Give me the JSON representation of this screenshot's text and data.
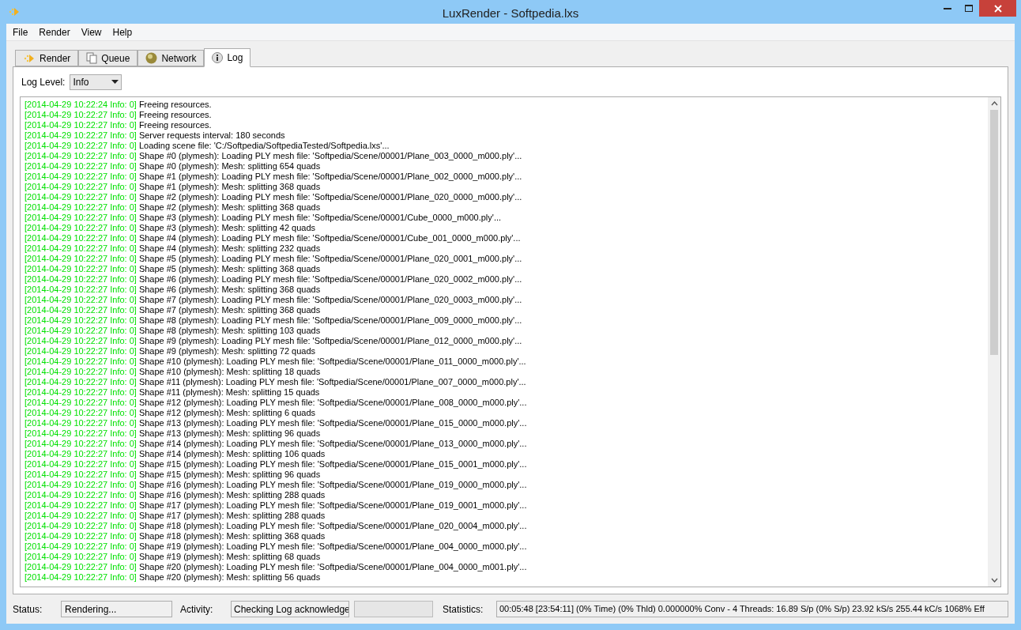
{
  "window": {
    "title": "LuxRender - Softpedia.lxs"
  },
  "menu": [
    "File",
    "Render",
    "View",
    "Help"
  ],
  "tabs": [
    {
      "label": "Render",
      "kind": "render",
      "selected": false
    },
    {
      "label": "Queue",
      "kind": "queue",
      "selected": false
    },
    {
      "label": "Network",
      "kind": "network",
      "selected": false
    },
    {
      "label": "Log",
      "kind": "info",
      "selected": true
    }
  ],
  "log_level": {
    "label": "Log Level:",
    "value": "Info"
  },
  "log": [
    {
      "prefix": "[2014-04-29 10:22:24 Info: 0]",
      "message": "Freeing resources."
    },
    {
      "prefix": "[2014-04-29 10:22:27 Info: 0]",
      "message": "Freeing resources."
    },
    {
      "prefix": "[2014-04-29 10:22:27 Info: 0]",
      "message": "Freeing resources."
    },
    {
      "prefix": "[2014-04-29 10:22:27 Info: 0]",
      "message": "Server requests interval: 180 seconds"
    },
    {
      "prefix": "[2014-04-29 10:22:27 Info: 0]",
      "message": "Loading scene file: 'C:/Softpedia/SoftpediaTested/Softpedia.lxs'..."
    },
    {
      "prefix": "[2014-04-29 10:22:27 Info: 0]",
      "message": "Shape #0 (plymesh): Loading PLY mesh file: 'Softpedia/Scene/00001/Plane_003_0000_m000.ply'..."
    },
    {
      "prefix": "[2014-04-29 10:22:27 Info: 0]",
      "message": "Shape #0 (plymesh): Mesh: splitting 654 quads"
    },
    {
      "prefix": "[2014-04-29 10:22:27 Info: 0]",
      "message": "Shape #1 (plymesh): Loading PLY mesh file: 'Softpedia/Scene/00001/Plane_002_0000_m000.ply'..."
    },
    {
      "prefix": "[2014-04-29 10:22:27 Info: 0]",
      "message": "Shape #1 (plymesh): Mesh: splitting 368 quads"
    },
    {
      "prefix": "[2014-04-29 10:22:27 Info: 0]",
      "message": "Shape #2 (plymesh): Loading PLY mesh file: 'Softpedia/Scene/00001/Plane_020_0000_m000.ply'..."
    },
    {
      "prefix": "[2014-04-29 10:22:27 Info: 0]",
      "message": "Shape #2 (plymesh): Mesh: splitting 368 quads"
    },
    {
      "prefix": "[2014-04-29 10:22:27 Info: 0]",
      "message": "Shape #3 (plymesh): Loading PLY mesh file: 'Softpedia/Scene/00001/Cube_0000_m000.ply'..."
    },
    {
      "prefix": "[2014-04-29 10:22:27 Info: 0]",
      "message": "Shape #3 (plymesh): Mesh: splitting 42 quads"
    },
    {
      "prefix": "[2014-04-29 10:22:27 Info: 0]",
      "message": "Shape #4 (plymesh): Loading PLY mesh file: 'Softpedia/Scene/00001/Cube_001_0000_m000.ply'..."
    },
    {
      "prefix": "[2014-04-29 10:22:27 Info: 0]",
      "message": "Shape #4 (plymesh): Mesh: splitting 232 quads"
    },
    {
      "prefix": "[2014-04-29 10:22:27 Info: 0]",
      "message": "Shape #5 (plymesh): Loading PLY mesh file: 'Softpedia/Scene/00001/Plane_020_0001_m000.ply'..."
    },
    {
      "prefix": "[2014-04-29 10:22:27 Info: 0]",
      "message": "Shape #5 (plymesh): Mesh: splitting 368 quads"
    },
    {
      "prefix": "[2014-04-29 10:22:27 Info: 0]",
      "message": "Shape #6 (plymesh): Loading PLY mesh file: 'Softpedia/Scene/00001/Plane_020_0002_m000.ply'..."
    },
    {
      "prefix": "[2014-04-29 10:22:27 Info: 0]",
      "message": "Shape #6 (plymesh): Mesh: splitting 368 quads"
    },
    {
      "prefix": "[2014-04-29 10:22:27 Info: 0]",
      "message": "Shape #7 (plymesh): Loading PLY mesh file: 'Softpedia/Scene/00001/Plane_020_0003_m000.ply'..."
    },
    {
      "prefix": "[2014-04-29 10:22:27 Info: 0]",
      "message": "Shape #7 (plymesh): Mesh: splitting 368 quads"
    },
    {
      "prefix": "[2014-04-29 10:22:27 Info: 0]",
      "message": "Shape #8 (plymesh): Loading PLY mesh file: 'Softpedia/Scene/00001/Plane_009_0000_m000.ply'..."
    },
    {
      "prefix": "[2014-04-29 10:22:27 Info: 0]",
      "message": "Shape #8 (plymesh): Mesh: splitting 103 quads"
    },
    {
      "prefix": "[2014-04-29 10:22:27 Info: 0]",
      "message": "Shape #9 (plymesh): Loading PLY mesh file: 'Softpedia/Scene/00001/Plane_012_0000_m000.ply'..."
    },
    {
      "prefix": "[2014-04-29 10:22:27 Info: 0]",
      "message": "Shape #9 (plymesh): Mesh: splitting 72 quads"
    },
    {
      "prefix": "[2014-04-29 10:22:27 Info: 0]",
      "message": "Shape #10 (plymesh): Loading PLY mesh file: 'Softpedia/Scene/00001/Plane_011_0000_m000.ply'..."
    },
    {
      "prefix": "[2014-04-29 10:22:27 Info: 0]",
      "message": "Shape #10 (plymesh): Mesh: splitting 18 quads"
    },
    {
      "prefix": "[2014-04-29 10:22:27 Info: 0]",
      "message": "Shape #11 (plymesh): Loading PLY mesh file: 'Softpedia/Scene/00001/Plane_007_0000_m000.ply'..."
    },
    {
      "prefix": "[2014-04-29 10:22:27 Info: 0]",
      "message": "Shape #11 (plymesh): Mesh: splitting 15 quads"
    },
    {
      "prefix": "[2014-04-29 10:22:27 Info: 0]",
      "message": "Shape #12 (plymesh): Loading PLY mesh file: 'Softpedia/Scene/00001/Plane_008_0000_m000.ply'..."
    },
    {
      "prefix": "[2014-04-29 10:22:27 Info: 0]",
      "message": "Shape #12 (plymesh): Mesh: splitting 6 quads"
    },
    {
      "prefix": "[2014-04-29 10:22:27 Info: 0]",
      "message": "Shape #13 (plymesh): Loading PLY mesh file: 'Softpedia/Scene/00001/Plane_015_0000_m000.ply'..."
    },
    {
      "prefix": "[2014-04-29 10:22:27 Info: 0]",
      "message": "Shape #13 (plymesh): Mesh: splitting 96 quads"
    },
    {
      "prefix": "[2014-04-29 10:22:27 Info: 0]",
      "message": "Shape #14 (plymesh): Loading PLY mesh file: 'Softpedia/Scene/00001/Plane_013_0000_m000.ply'..."
    },
    {
      "prefix": "[2014-04-29 10:22:27 Info: 0]",
      "message": "Shape #14 (plymesh): Mesh: splitting 106 quads"
    },
    {
      "prefix": "[2014-04-29 10:22:27 Info: 0]",
      "message": "Shape #15 (plymesh): Loading PLY mesh file: 'Softpedia/Scene/00001/Plane_015_0001_m000.ply'..."
    },
    {
      "prefix": "[2014-04-29 10:22:27 Info: 0]",
      "message": "Shape #15 (plymesh): Mesh: splitting 96 quads"
    },
    {
      "prefix": "[2014-04-29 10:22:27 Info: 0]",
      "message": "Shape #16 (plymesh): Loading PLY mesh file: 'Softpedia/Scene/00001/Plane_019_0000_m000.ply'..."
    },
    {
      "prefix": "[2014-04-29 10:22:27 Info: 0]",
      "message": "Shape #16 (plymesh): Mesh: splitting 288 quads"
    },
    {
      "prefix": "[2014-04-29 10:22:27 Info: 0]",
      "message": "Shape #17 (plymesh): Loading PLY mesh file: 'Softpedia/Scene/00001/Plane_019_0001_m000.ply'..."
    },
    {
      "prefix": "[2014-04-29 10:22:27 Info: 0]",
      "message": "Shape #17 (plymesh): Mesh: splitting 288 quads"
    },
    {
      "prefix": "[2014-04-29 10:22:27 Info: 0]",
      "message": "Shape #18 (plymesh): Loading PLY mesh file: 'Softpedia/Scene/00001/Plane_020_0004_m000.ply'..."
    },
    {
      "prefix": "[2014-04-29 10:22:27 Info: 0]",
      "message": "Shape #18 (plymesh): Mesh: splitting 368 quads"
    },
    {
      "prefix": "[2014-04-29 10:22:27 Info: 0]",
      "message": "Shape #19 (plymesh): Loading PLY mesh file: 'Softpedia/Scene/00001/Plane_004_0000_m000.ply'..."
    },
    {
      "prefix": "[2014-04-29 10:22:27 Info: 0]",
      "message": "Shape #19 (plymesh): Mesh: splitting 68 quads"
    },
    {
      "prefix": "[2014-04-29 10:22:27 Info: 0]",
      "message": "Shape #20 (plymesh): Loading PLY mesh file: 'Softpedia/Scene/00001/Plane_004_0000_m001.ply'..."
    },
    {
      "prefix": "[2014-04-29 10:22:27 Info: 0]",
      "message": "Shape #20 (plymesh): Mesh: splitting 56 quads"
    }
  ],
  "status_bar": {
    "progress": {
      "level": 0
    },
    "status_label": "Status:",
    "status": "Rendering...",
    "activity_label": "Activity:",
    "activity": "Checking Log acknowledge",
    "statistics_label": "Statistics:",
    "statistics": "00:05:48 [23:54:11] (0% Time) (0% Thld) 0.000000% Conv - 4 Threads: 16.89 S/p (0% S/p) 23.92 kS/s 255.44 kC/s 1068% Eff"
  }
}
